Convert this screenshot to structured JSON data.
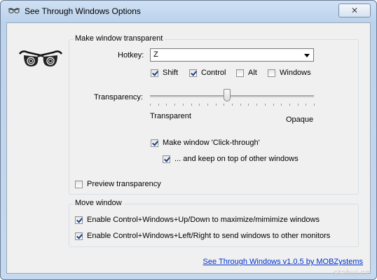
{
  "window": {
    "title": "See Through Windows Options",
    "close_glyph": "✕"
  },
  "transparent_group": {
    "legend": "Make window transparent",
    "hotkey_label": "Hotkey:",
    "hotkey_value": "Z",
    "modifiers": [
      {
        "label": "Shift",
        "checked": true
      },
      {
        "label": "Control",
        "checked": true
      },
      {
        "label": "Alt",
        "checked": false
      },
      {
        "label": "Windows",
        "checked": false
      }
    ],
    "transparency_label": "Transparency:",
    "slider_value_percent": 47,
    "slider_min_label": "Transparent",
    "slider_max_label": "Opaque",
    "click_through": {
      "label": "Make window 'Click-through'",
      "checked": true
    },
    "keep_on_top": {
      "label": "... and keep on top of other windows",
      "checked": true
    },
    "preview": {
      "label": "Preview transparency",
      "checked": false
    }
  },
  "move_group": {
    "legend": "Move window",
    "options": [
      {
        "label": "Enable Control+Windows+Up/Down to maximize/mimimize windows",
        "checked": true
      },
      {
        "label": "Enable Control+Windows+Left/Right to send windows to other monitors",
        "checked": true
      }
    ]
  },
  "footer": {
    "link_text": "See Through Windows v1.0.5 by MOBZystems",
    "watermark": "stahuj.cz"
  },
  "icons": {
    "app": "glasses-icon",
    "logo": "3d-glasses-icon",
    "close": "close-icon"
  }
}
